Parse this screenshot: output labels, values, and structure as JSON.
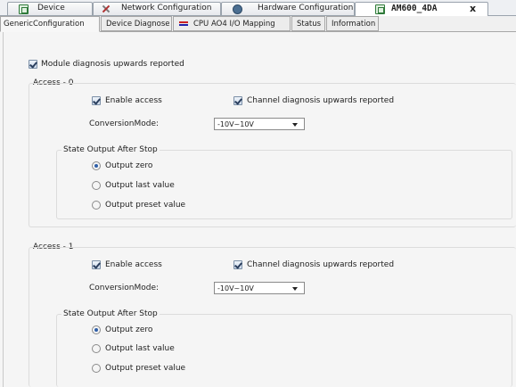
{
  "document_tabs": [
    {
      "label": "Device",
      "icon": "device-icon"
    },
    {
      "label": "Network Configuration",
      "icon": "network-config-icon"
    },
    {
      "label": "Hardware Configuration",
      "icon": "hardware-config-icon"
    },
    {
      "label": "AM600_4DA",
      "icon": "device-icon",
      "active": true,
      "close": "x"
    }
  ],
  "sub_tabs": [
    {
      "label": "GenericConfiguration",
      "active": true
    },
    {
      "label": "Device Diagnose"
    },
    {
      "label": "CPU AO4 I/O Mapping",
      "icon": "io-mapping-icon"
    },
    {
      "label": "Status"
    },
    {
      "label": "Information"
    }
  ],
  "module_diag": {
    "label": "Module diagnosis upwards reported",
    "checked": true
  },
  "access": [
    {
      "title": "Access - 0",
      "enable_access": {
        "label": "Enable access",
        "checked": true
      },
      "channel_diag": {
        "label": "Channel diagnosis upwards reported",
        "checked": true
      },
      "conversion_label": "ConversionMode:",
      "conversion_value": "-10V~10V",
      "state_title": "State Output After Stop",
      "options": [
        "Output zero",
        "Output last value",
        "Output preset value"
      ],
      "selected": "Output zero"
    },
    {
      "title": "Access - 1",
      "enable_access": {
        "label": "Enable access",
        "checked": true
      },
      "channel_diag": {
        "label": "Channel diagnosis upwards reported",
        "checked": true
      },
      "conversion_label": "ConversionMode:",
      "conversion_value": "-10V~10V",
      "state_title": "State Output After Stop",
      "options": [
        "Output zero",
        "Output last value",
        "Output preset value"
      ],
      "selected": "Output zero"
    }
  ]
}
